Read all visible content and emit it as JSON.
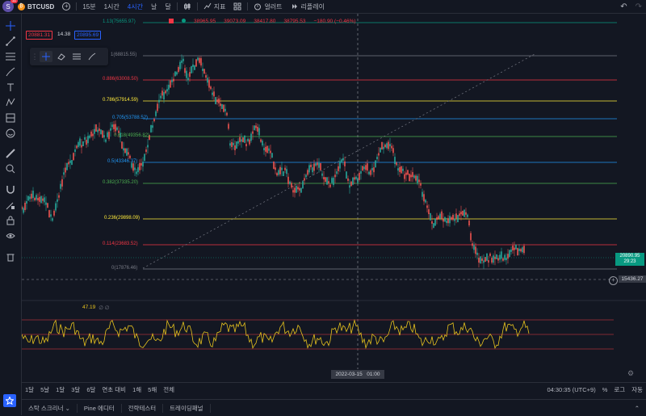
{
  "header": {
    "avatar_letter": "S",
    "badge": "11",
    "coin_glyph": "₿",
    "symbol": "BTCUSD",
    "add_glyph": "+",
    "timeframes": [
      "15분",
      "1시간",
      "4시간",
      "날",
      "달"
    ],
    "active_timeframe": "4시간",
    "indicator_label": "지표",
    "alert_label": "얼러트",
    "replay_label": "리플레이",
    "undo_glyph": "↶",
    "redo_glyph": "↷"
  },
  "ohlc": {
    "open": "38965.95",
    "high": "39073.09",
    "low": "38417.80",
    "close": "38795.53",
    "change": "−180.90 (−0.46%)"
  },
  "price_boxes": {
    "sell": "20881.31",
    "spread": "14.38",
    "buy": "20895.69"
  },
  "fib_levels": [
    {
      "label": "1.13(75655.97)",
      "color": "#089981"
    },
    {
      "label": "1(68815.55)",
      "color": "#787b86"
    },
    {
      "label": "0.886(63008.50)",
      "color": "#f23645"
    },
    {
      "label": "0.786(57914.59)",
      "color": "#ffeb3b"
    },
    {
      "label": "0.705(53788.52)",
      "color": "#2196f3"
    },
    {
      "label": "0.618(49356.82)",
      "color": "#4caf50"
    },
    {
      "label": "0.5(43346.37)",
      "color": "#2196f3"
    },
    {
      "label": "0.382(37335.20)",
      "color": "#4caf50"
    },
    {
      "label": "0.236(29898.09)",
      "color": "#ffeb3b"
    },
    {
      "label": "0.114(23683.52)",
      "color": "#f23645"
    },
    {
      "label": "0(17876.46)",
      "color": "#787b86"
    }
  ],
  "current_price": {
    "value": "20890.95",
    "countdown": "29:23",
    "color": "#089981"
  },
  "crosshair_price": "15436.27",
  "crosshair_add_glyph": "+",
  "oscillator": {
    "value": "47.19",
    "marks": "∅ ∅",
    "color": "#e8c31e"
  },
  "crosshair_time": "2022-03-15   01:00",
  "date_ranges": [
    "1달",
    "5날",
    "1달",
    "3달",
    "6달",
    "연초 대비",
    "1해",
    "5해",
    "전체"
  ],
  "clock": "04:30:35 (UTC+9)",
  "axis_options": [
    "%",
    "로그",
    "자동"
  ],
  "panels": [
    "스탁 스크리너 ⌄",
    "Pine 에디터",
    "전략테스터",
    "트레이딩패널"
  ],
  "series_color": "#26a69a",
  "down_color": "#ef5350"
}
